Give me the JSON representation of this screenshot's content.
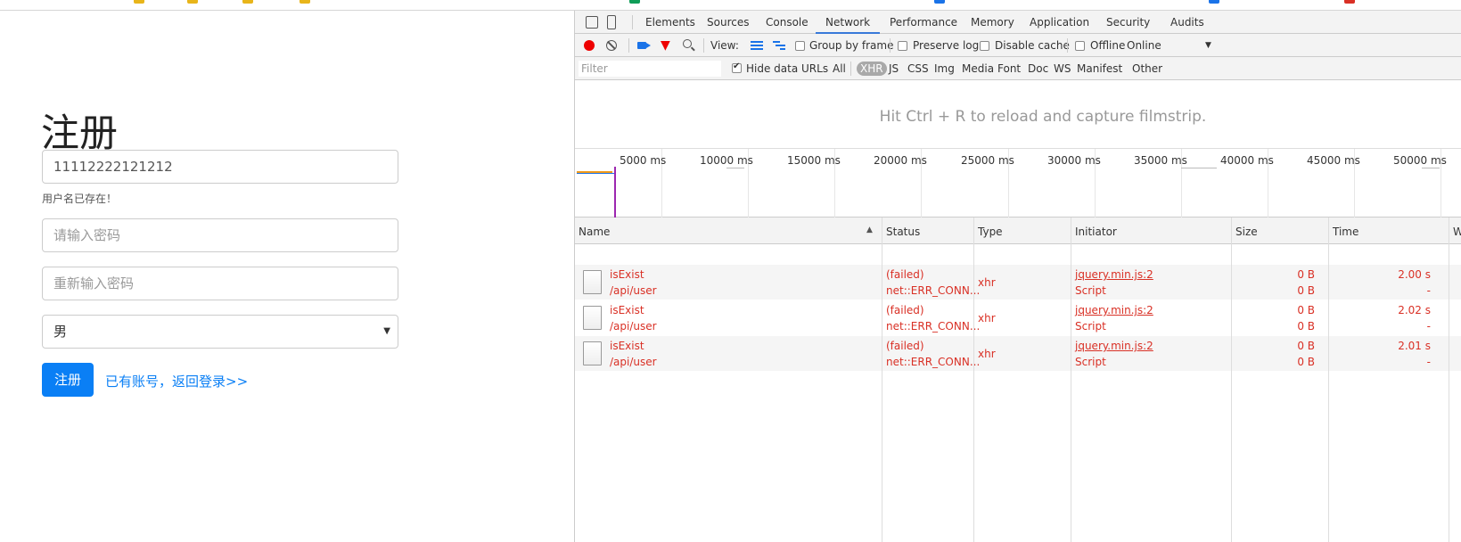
{
  "register": {
    "title": "注册",
    "username_value": "11112222121212",
    "username_hint": "用户名已存在！",
    "password_placeholder": "请输入密码",
    "confirm_placeholder": "重新输入密码",
    "gender_value": "男",
    "submit_label": "注册",
    "login_link": "已有账号，返回登录>>"
  },
  "devtools": {
    "tabs": [
      "Elements",
      "Sources",
      "Console",
      "Network",
      "Performance",
      "Memory",
      "Application",
      "Security",
      "Audits"
    ],
    "active_tab": "Network",
    "toolbar": {
      "view_label": "View:",
      "group_by_frame": "Group by frame",
      "preserve_log": "Preserve log",
      "disable_cache": "Disable cache",
      "offline": "Offline",
      "throttle": "Online"
    },
    "filter": {
      "placeholder": "Filter",
      "hide_data_urls": "Hide data URLs",
      "types": [
        "All",
        "XHR",
        "JS",
        "CSS",
        "Img",
        "Media",
        "Font",
        "Doc",
        "WS",
        "Manifest",
        "Other"
      ],
      "selected_type": "XHR"
    },
    "filmstrip_message": "Hit Ctrl + R to reload and capture filmstrip.",
    "timeline_ticks": [
      "5000 ms",
      "10000 ms",
      "15000 ms",
      "20000 ms",
      "25000 ms",
      "30000 ms",
      "35000 ms",
      "40000 ms",
      "45000 ms",
      "50000 ms"
    ],
    "columns": [
      "Name",
      "Status",
      "Type",
      "Initiator",
      "Size",
      "Time",
      "W"
    ],
    "requests": [
      {
        "name": "isExist",
        "path": "/api/user",
        "status": "(failed)",
        "status_detail": "net::ERR_CONN...",
        "type": "xhr",
        "initiator": "jquery.min.js:2",
        "initiator_type": "Script",
        "size": "0 B",
        "size2": "0 B",
        "time": "2.00 s",
        "time2": "-"
      },
      {
        "name": "isExist",
        "path": "/api/user",
        "status": "(failed)",
        "status_detail": "net::ERR_CONN...",
        "type": "xhr",
        "initiator": "jquery.min.js:2",
        "initiator_type": "Script",
        "size": "0 B",
        "size2": "0 B",
        "time": "2.02 s",
        "time2": "-"
      },
      {
        "name": "isExist",
        "path": "/api/user",
        "status": "(failed)",
        "status_detail": "net::ERR_CONN...",
        "type": "xhr",
        "initiator": "jquery.min.js:2",
        "initiator_type": "Script",
        "size": "0 B",
        "size2": "0 B",
        "time": "2.01 s",
        "time2": "-"
      }
    ],
    "colors": {
      "error": "#d93025",
      "accent": "#1a73e8",
      "record": "#ee0000"
    }
  }
}
